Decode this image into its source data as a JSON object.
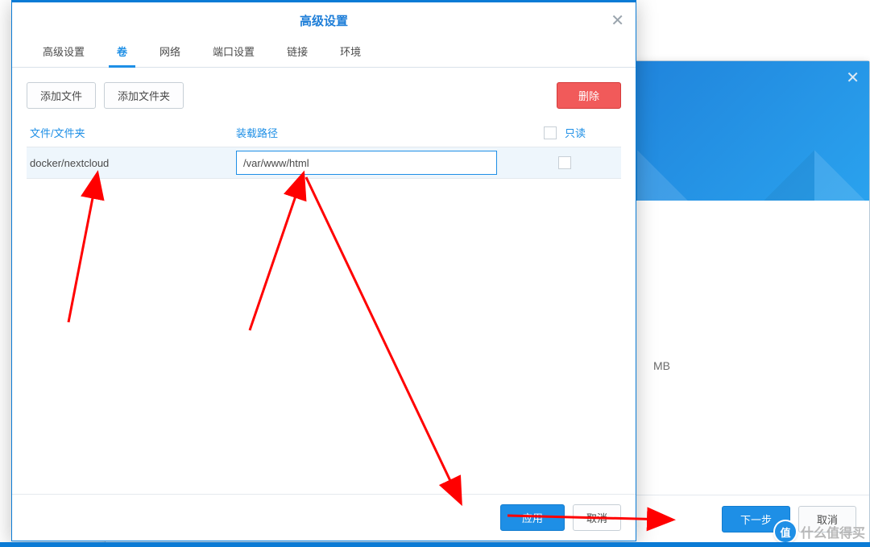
{
  "modal": {
    "title": "高级设置",
    "tabs": [
      "高级设置",
      "卷",
      "网络",
      "端口设置",
      "链接",
      "环境"
    ],
    "active_tab_index": 1,
    "buttons": {
      "add_file": "添加文件",
      "add_folder": "添加文件夹",
      "delete": "删除",
      "apply": "应用",
      "cancel": "取消"
    },
    "columns": {
      "folder": "文件/文件夹",
      "path": "装载路径",
      "readonly": "只读"
    },
    "rows": [
      {
        "folder": "docker/nextcloud",
        "path": "/var/www/html",
        "readonly": false
      }
    ]
  },
  "bg": {
    "mb_label": "MB",
    "next": "下一步",
    "cancel": "取消"
  },
  "watermark": {
    "badge": "值",
    "text": "什么值得买"
  }
}
